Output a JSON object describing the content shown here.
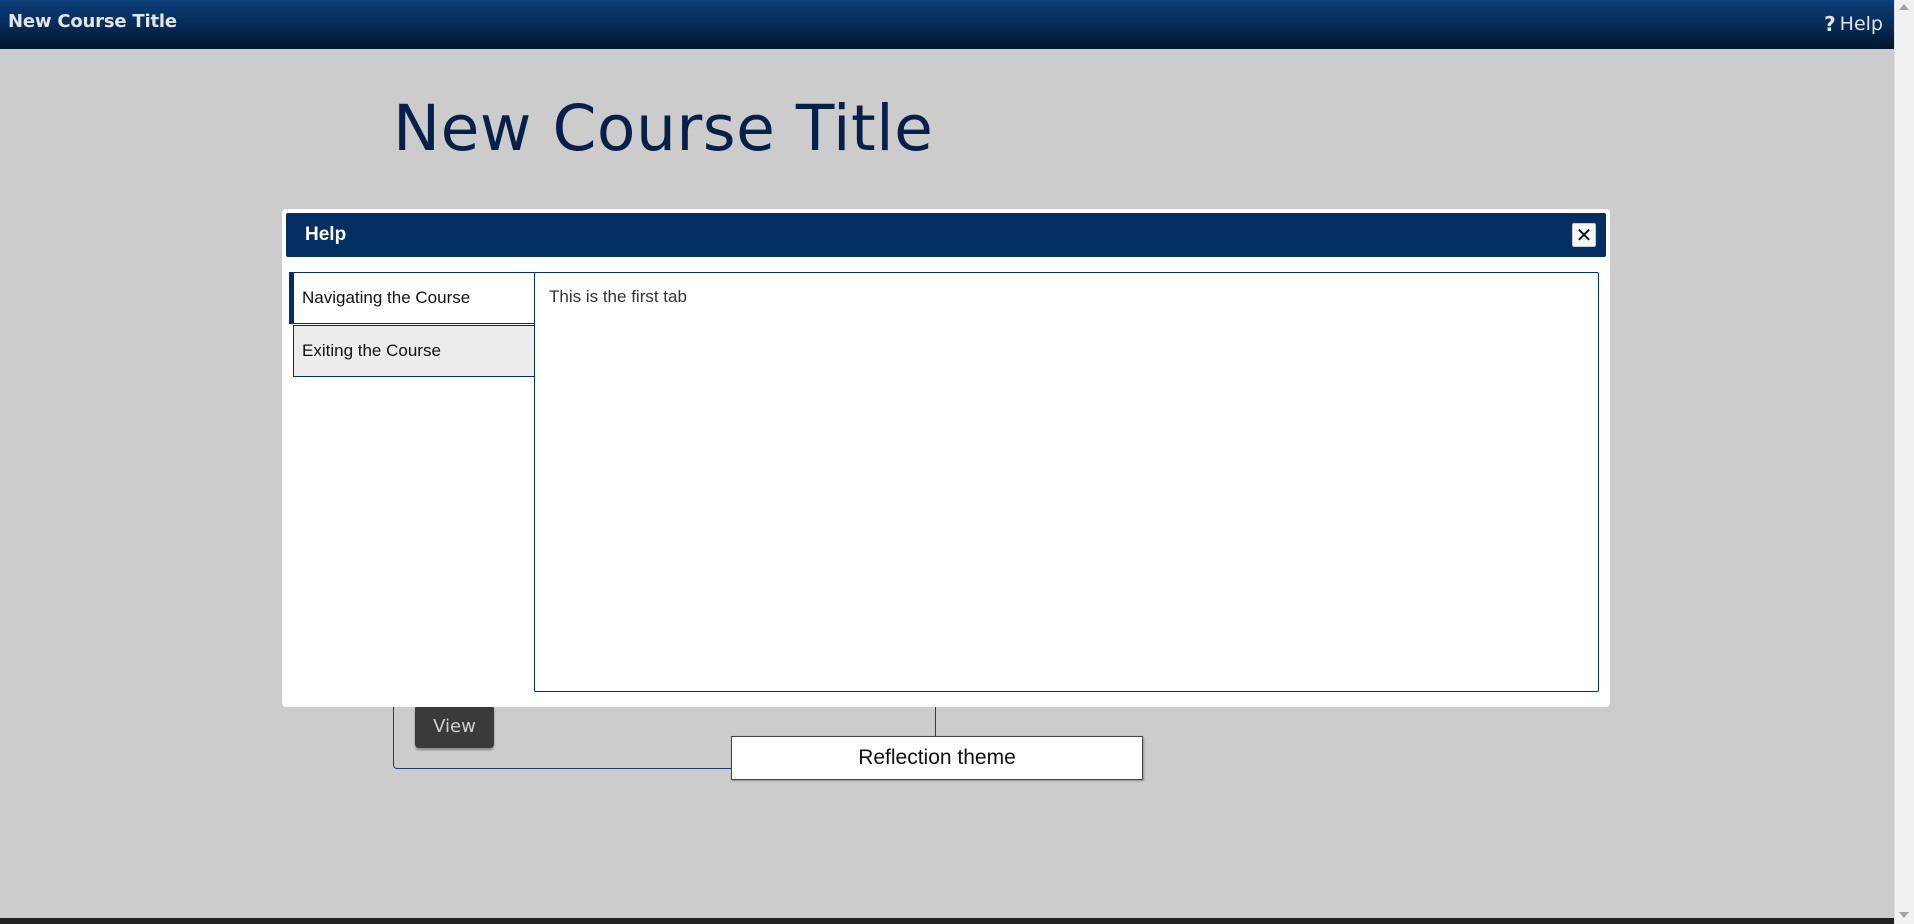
{
  "navbar": {
    "title": "New Course Title",
    "help_icon": "question-mark-icon",
    "help_label": "Help"
  },
  "page": {
    "heading": "New Course Title",
    "view_button_label": "View",
    "reflection_label": "Reflection theme"
  },
  "dialog": {
    "title": "Help",
    "close_icon": "close-icon",
    "close_glyph": "✕",
    "tabs": [
      {
        "label": "Navigating the Course",
        "active": true
      },
      {
        "label": "Exiting the Course",
        "active": false
      }
    ],
    "panel_text": "This is the first tab"
  },
  "colors": {
    "navbar_dark": "#02162d",
    "navbar_light": "#0b3e78",
    "dialog_header": "#042f63",
    "page_background": "#cccccc",
    "heading_color": "#06204a"
  }
}
